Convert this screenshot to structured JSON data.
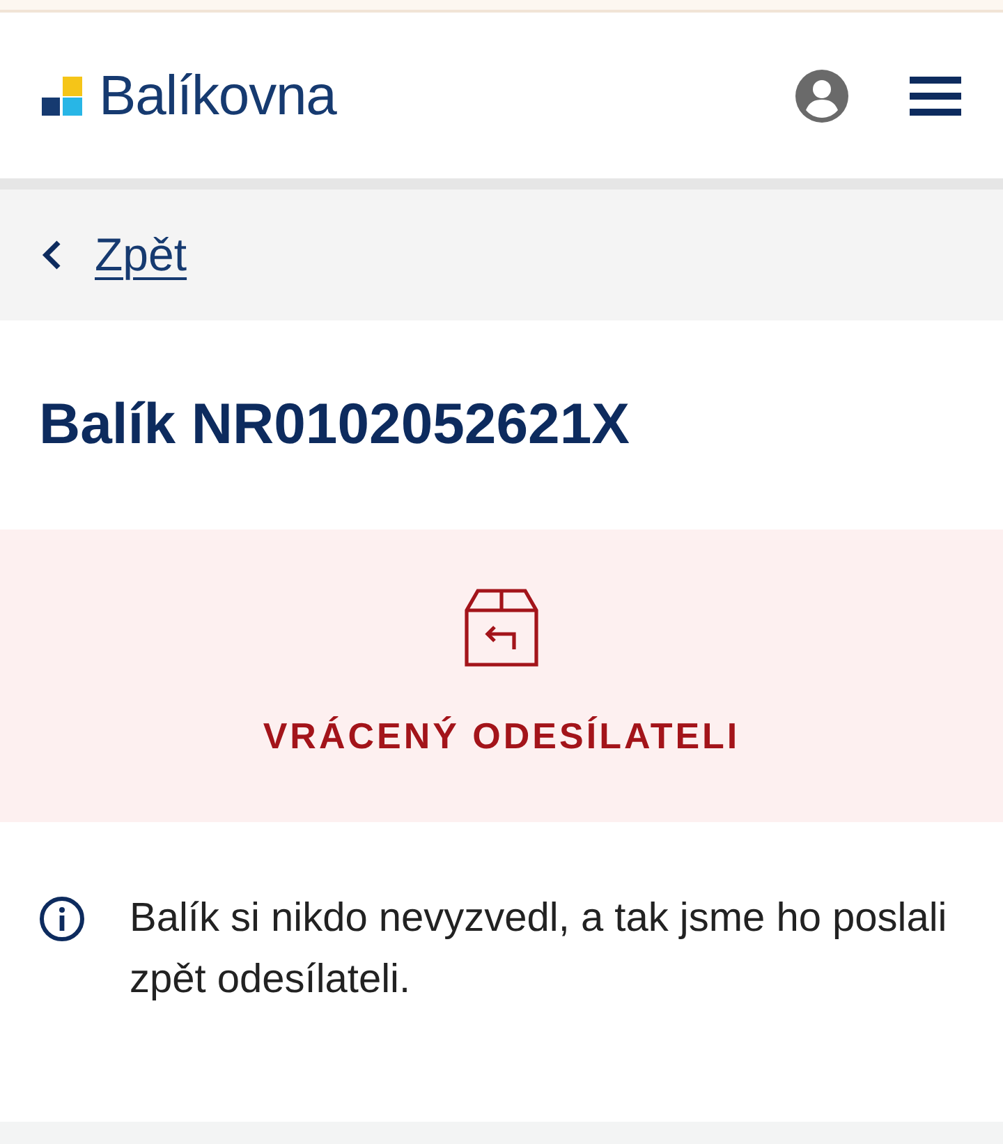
{
  "header": {
    "logo": {
      "text": "Balíkovna"
    }
  },
  "back_link": {
    "label": "Zpět"
  },
  "parcel": {
    "title": "Balík NR0102052621X"
  },
  "status": {
    "kind": "returned",
    "label": "VRÁCENÝ ODESÍLATELI"
  },
  "info": {
    "text": "Balík si nikdo nevyzvedl, a tak jsme ho poslali zpět odesílateli."
  }
}
